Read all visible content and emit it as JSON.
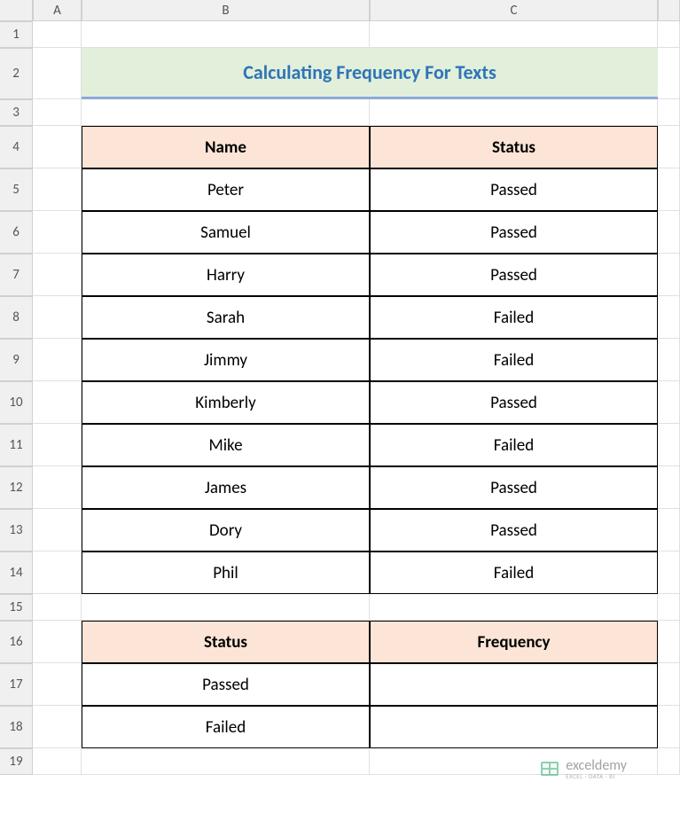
{
  "columns": {
    "A": "A",
    "B": "B",
    "C": "C"
  },
  "rows": [
    "1",
    "2",
    "3",
    "4",
    "5",
    "6",
    "7",
    "8",
    "9",
    "10",
    "11",
    "12",
    "13",
    "14",
    "15",
    "16",
    "17",
    "18",
    "19"
  ],
  "title": "Calculating Frequency For Texts",
  "table1": {
    "headers": {
      "name": "Name",
      "status": "Status"
    },
    "rows": [
      {
        "name": "Peter",
        "status": "Passed"
      },
      {
        "name": "Samuel",
        "status": "Passed"
      },
      {
        "name": "Harry",
        "status": "Passed"
      },
      {
        "name": "Sarah",
        "status": "Failed"
      },
      {
        "name": "Jimmy",
        "status": "Failed"
      },
      {
        "name": "Kimberly",
        "status": "Passed"
      },
      {
        "name": "Mike",
        "status": "Failed"
      },
      {
        "name": "James",
        "status": "Passed"
      },
      {
        "name": "Dory",
        "status": "Passed"
      },
      {
        "name": "Phil",
        "status": "Failed"
      }
    ]
  },
  "table2": {
    "headers": {
      "status": "Status",
      "frequency": "Frequency"
    },
    "rows": [
      {
        "status": "Passed",
        "frequency": ""
      },
      {
        "status": "Failed",
        "frequency": ""
      }
    ]
  },
  "watermark": {
    "main": "exceldemy",
    "sub": "EXCEL · DATA · BI"
  }
}
